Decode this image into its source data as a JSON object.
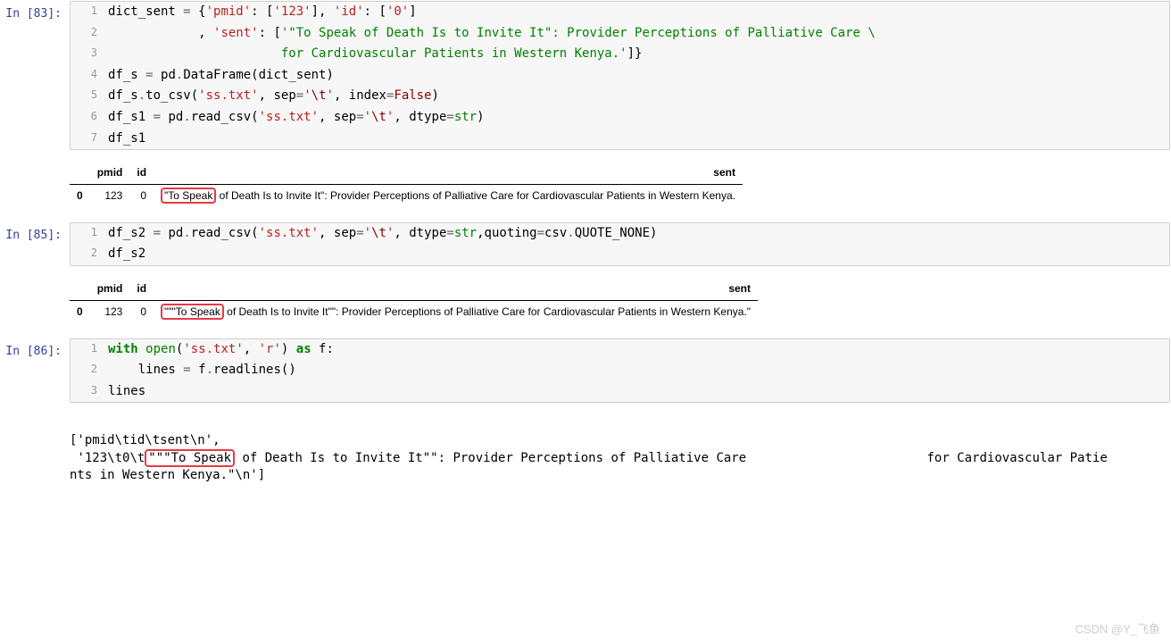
{
  "cells": [
    {
      "prompt": "In [83]:",
      "lines": [
        [
          {
            "t": "dict_sent ",
            "c": ""
          },
          {
            "t": "=",
            "c": "s-op"
          },
          {
            "t": " {",
            "c": ""
          },
          {
            "t": "'pmid'",
            "c": "s-str"
          },
          {
            "t": ": [",
            "c": ""
          },
          {
            "t": "'123'",
            "c": "s-str"
          },
          {
            "t": "], ",
            "c": ""
          },
          {
            "t": "'id'",
            "c": "s-str"
          },
          {
            "t": ": [",
            "c": ""
          },
          {
            "t": "'0'",
            "c": "s-str"
          },
          {
            "t": "]",
            "c": ""
          }
        ],
        [
          {
            "t": "            , ",
            "c": ""
          },
          {
            "t": "'sent'",
            "c": "s-str"
          },
          {
            "t": ": [",
            "c": ""
          },
          {
            "t": "'\"To Speak of Death Is to Invite It\": Provider Perceptions of Palliative Care ",
            "c": "s-green"
          },
          {
            "t": "\\",
            "c": "s-green"
          }
        ],
        [
          {
            "t": "                       for Cardiovascular Patients in Western Kenya.'",
            "c": "s-green"
          },
          {
            "t": "]}",
            "c": ""
          }
        ],
        [
          {
            "t": "df_s ",
            "c": ""
          },
          {
            "t": "=",
            "c": "s-op"
          },
          {
            "t": " pd",
            "c": ""
          },
          {
            "t": ".",
            "c": "s-op"
          },
          {
            "t": "DataFrame(dict_sent)",
            "c": ""
          }
        ],
        [
          {
            "t": "df_s",
            "c": ""
          },
          {
            "t": ".",
            "c": "s-op"
          },
          {
            "t": "to_csv(",
            "c": ""
          },
          {
            "t": "'ss.txt'",
            "c": "s-str"
          },
          {
            "t": ", sep",
            "c": ""
          },
          {
            "t": "=",
            "c": "s-op"
          },
          {
            "t": "'",
            "c": "s-str"
          },
          {
            "t": "\\t",
            "c": "s-const"
          },
          {
            "t": "'",
            "c": "s-str"
          },
          {
            "t": ", index",
            "c": ""
          },
          {
            "t": "=",
            "c": "s-op"
          },
          {
            "t": "False",
            "c": "s-const"
          },
          {
            "t": ")",
            "c": ""
          }
        ],
        [
          {
            "t": "df_s1 ",
            "c": ""
          },
          {
            "t": "=",
            "c": "s-op"
          },
          {
            "t": " pd",
            "c": ""
          },
          {
            "t": ".",
            "c": "s-op"
          },
          {
            "t": "read_csv(",
            "c": ""
          },
          {
            "t": "'ss.txt'",
            "c": "s-str"
          },
          {
            "t": ", sep",
            "c": ""
          },
          {
            "t": "=",
            "c": "s-op"
          },
          {
            "t": "'",
            "c": "s-str"
          },
          {
            "t": "\\t",
            "c": "s-const"
          },
          {
            "t": "'",
            "c": "s-str"
          },
          {
            "t": ", dtype",
            "c": ""
          },
          {
            "t": "=",
            "c": "s-op"
          },
          {
            "t": "str",
            "c": "s-builtin"
          },
          {
            "t": ")",
            "c": ""
          }
        ],
        [
          {
            "t": "df_s1",
            "c": ""
          }
        ]
      ]
    },
    {
      "prompt": "In [85]:",
      "lines": [
        [
          {
            "t": "df_s2 ",
            "c": ""
          },
          {
            "t": "=",
            "c": "s-op"
          },
          {
            "t": " pd",
            "c": ""
          },
          {
            "t": ".",
            "c": "s-op"
          },
          {
            "t": "read_csv(",
            "c": ""
          },
          {
            "t": "'ss.txt'",
            "c": "s-str"
          },
          {
            "t": ", sep",
            "c": ""
          },
          {
            "t": "=",
            "c": "s-op"
          },
          {
            "t": "'",
            "c": "s-str"
          },
          {
            "t": "\\t",
            "c": "s-const"
          },
          {
            "t": "'",
            "c": "s-str"
          },
          {
            "t": ", dtype",
            "c": ""
          },
          {
            "t": "=",
            "c": "s-op"
          },
          {
            "t": "str",
            "c": "s-builtin"
          },
          {
            "t": ",quoting",
            "c": ""
          },
          {
            "t": "=",
            "c": "s-op"
          },
          {
            "t": "csv",
            "c": ""
          },
          {
            "t": ".",
            "c": "s-op"
          },
          {
            "t": "QUOTE_NONE)",
            "c": ""
          }
        ],
        [
          {
            "t": "df_s2",
            "c": ""
          }
        ]
      ]
    },
    {
      "prompt": "In [86]:",
      "lines": [
        [
          {
            "t": "with",
            "c": "s-kw"
          },
          {
            "t": " ",
            "c": ""
          },
          {
            "t": "open",
            "c": "s-builtin"
          },
          {
            "t": "(",
            "c": ""
          },
          {
            "t": "'ss.txt'",
            "c": "s-str"
          },
          {
            "t": ", ",
            "c": ""
          },
          {
            "t": "'r'",
            "c": "s-str"
          },
          {
            "t": ") ",
            "c": ""
          },
          {
            "t": "as",
            "c": "s-kw"
          },
          {
            "t": " f:",
            "c": ""
          }
        ],
        [
          {
            "t": "    lines ",
            "c": ""
          },
          {
            "t": "=",
            "c": "s-op"
          },
          {
            "t": " f",
            "c": ""
          },
          {
            "t": ".",
            "c": "s-op"
          },
          {
            "t": "readlines()",
            "c": ""
          }
        ],
        [
          {
            "t": "lines",
            "c": ""
          }
        ]
      ]
    }
  ],
  "df1": {
    "headers": [
      "",
      "pmid",
      "id",
      "sent"
    ],
    "row": {
      "idx": "0",
      "pmid": "123",
      "id": "0",
      "hl": "\"To Speak",
      "rest": " of Death Is to Invite It\": Provider Perceptions of Palliative Care   for Cardiovascular Patients in Western Kenya."
    }
  },
  "df2": {
    "headers": [
      "",
      "pmid",
      "id",
      "sent"
    ],
    "row": {
      "idx": "0",
      "pmid": "123",
      "id": "0",
      "hl": "\"\"\"To Speak",
      "rest": " of Death Is to Invite It\"\": Provider Perceptions of Palliative Care   for Cardiovascular Patients in Western Kenya.\""
    }
  },
  "lines_output": {
    "l1": "['pmid\\tid\\tsent\\n',",
    "l2_a": " '123\\t0\\t",
    "l2_hl": "\"\"\"To Speak",
    "l2_b": " of Death Is to Invite It\"\": Provider Perceptions of Palliative Care                        for Cardiovascular Patie",
    "l3": "nts in Western Kenya.\"\\n']"
  },
  "watermark": "CSDN @Y_飞鱼"
}
